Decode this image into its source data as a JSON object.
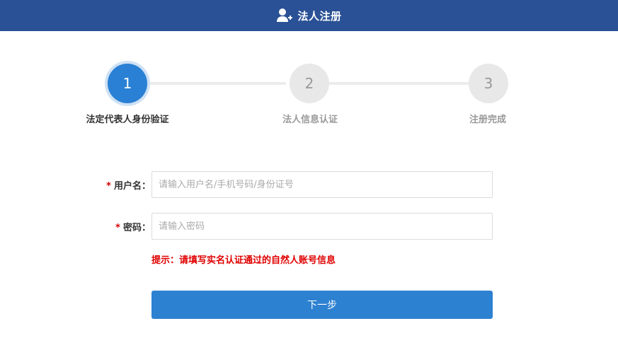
{
  "header": {
    "title": "法人注册",
    "icon": "user-add-icon",
    "bg_color": "#2a5195"
  },
  "steps": [
    {
      "number": "1",
      "label": "法定代表人身份验证",
      "state": "active"
    },
    {
      "number": "2",
      "label": "法人信息认证",
      "state": "inactive"
    },
    {
      "number": "3",
      "label": "注册完成",
      "state": "inactive"
    }
  ],
  "form": {
    "username": {
      "required_mark": "*",
      "label": "用户名：",
      "value": "",
      "placeholder": "请输入用户名/手机号码/身份证号"
    },
    "password": {
      "required_mark": "*",
      "label": "密码：",
      "value": "",
      "placeholder": "请输入密码"
    },
    "tip": "提示：请填写实名认证通过的自然人账号信息",
    "submit_label": "下一步"
  },
  "colors": {
    "accent": "#2d81d1",
    "error": "#e00000",
    "inactive": "#999999"
  }
}
